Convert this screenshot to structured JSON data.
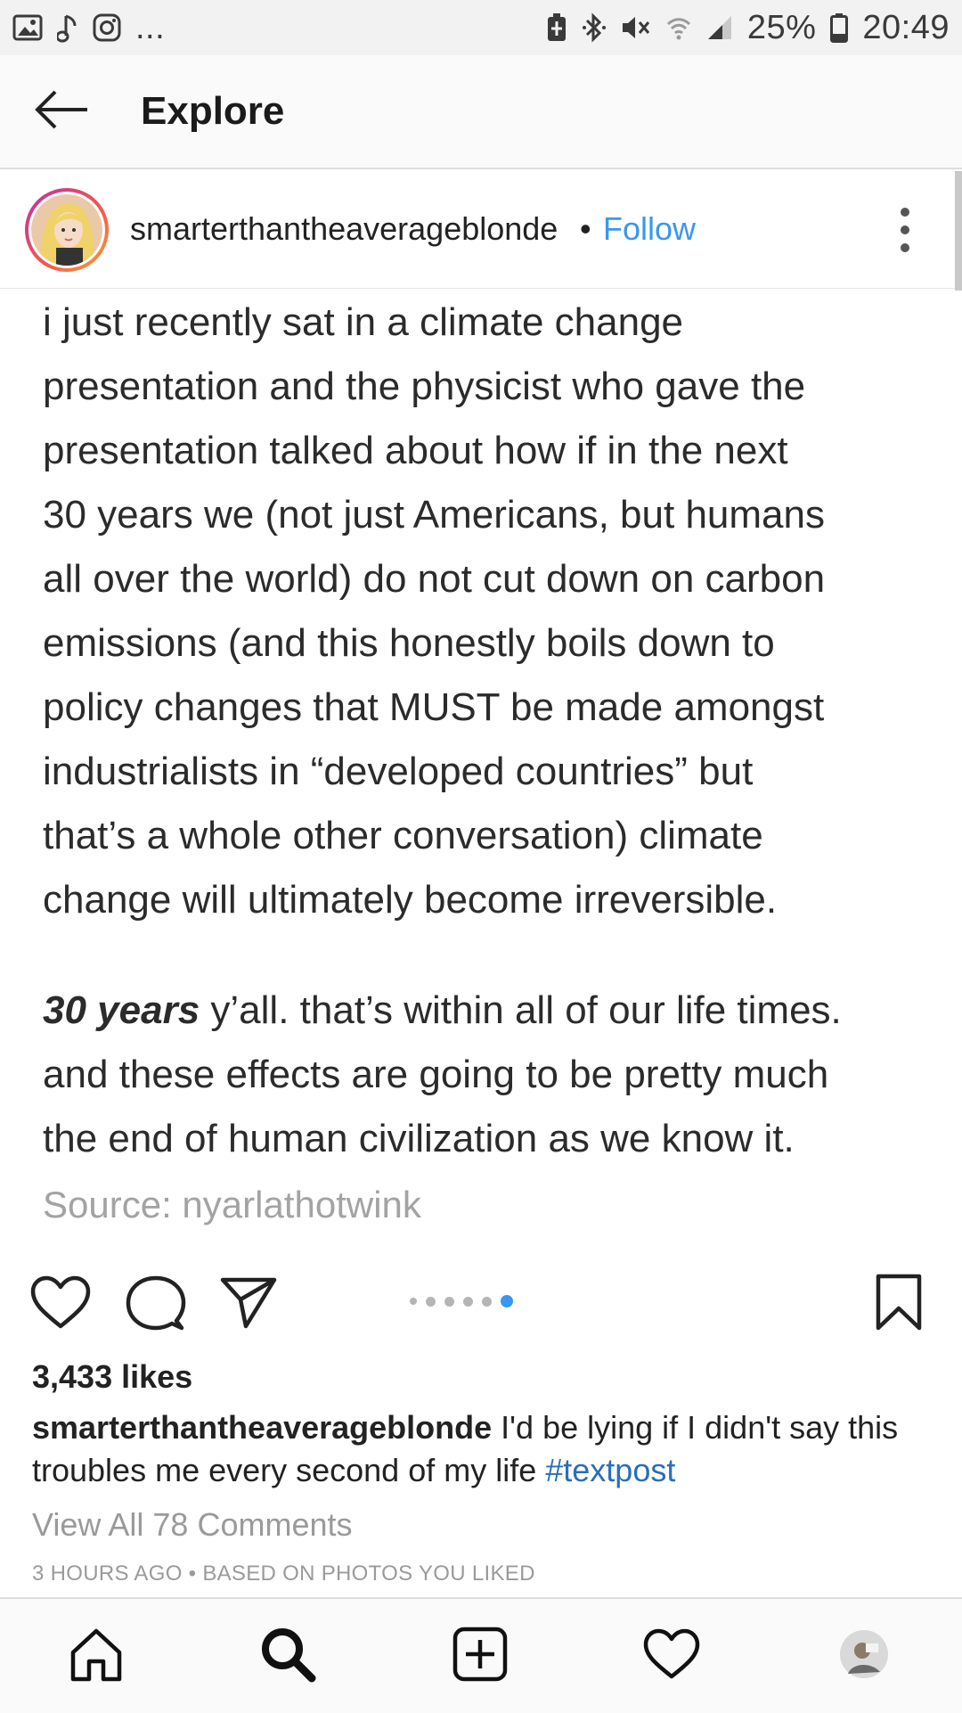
{
  "status_bar": {
    "left_icons": [
      "image-icon",
      "music-note-icon",
      "instagram-icon"
    ],
    "overflow": "...",
    "right_icons": [
      "battery-saver-icon",
      "bluetooth-icon",
      "mute-icon",
      "wifi-icon",
      "signal-icon"
    ],
    "battery_percent": "25%",
    "time": "20:49"
  },
  "header": {
    "back_icon": "arrow-left-icon",
    "title": "Explore"
  },
  "post": {
    "username": "smarterthantheaverageblonde",
    "separator": "•",
    "follow_label": "Follow",
    "more_icon": "kebab-menu-icon",
    "image_text": {
      "paragraph1_lines": [
        "i just recently sat in a climate change",
        "presentation and the physicist who gave the",
        "presentation talked about how if in the next",
        "30 years we (not just Americans, but humans",
        "all over the world) do not cut down on carbon",
        "emissions (and this honestly boils down to",
        "policy changes that MUST be made amongst",
        "industrialists in “developed countries” but",
        "that’s a whole other conversation) climate",
        "change will ultimately become irreversible."
      ],
      "paragraph2_bold": "30 years",
      "paragraph2_line1_rest": " y’all. that’s within all of our life times.",
      "paragraph2_line2": "and these effects are going to be pretty much",
      "paragraph2_line3": "the end of human civilization as we know it.",
      "source": "Source: nyarlathotwink"
    },
    "carousel": {
      "count": 6,
      "active_index": 5
    },
    "likes": "3,433 likes",
    "caption": {
      "username": "smarterthantheaverageblonde",
      "text": " I'd be lying if I didn't say this troubles me every second of my life ",
      "hashtag": "#textpost"
    },
    "view_comments": "View All 78 Comments",
    "timestamp": "3 HOURS AGO • BASED ON PHOTOS YOU LIKED"
  },
  "bottom_nav": {
    "items": [
      "home-icon",
      "search-icon",
      "add-post-icon",
      "activity-heart-icon",
      "profile-avatar"
    ]
  },
  "colors": {
    "link_blue": "#3897f0",
    "hashtag_blue": "#2a6eb7",
    "muted_text": "#9a9a9a",
    "status_bar_bg": "#f2f2f2"
  }
}
